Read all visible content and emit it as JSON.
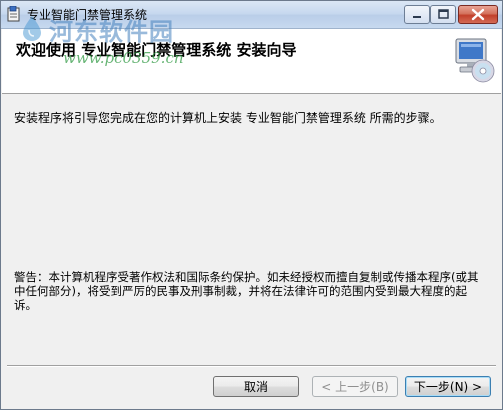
{
  "window": {
    "title": "专业智能门禁管理系统"
  },
  "watermark": {
    "site_name": "河东软件园",
    "url": "www.pc0359.cn"
  },
  "header": {
    "title": "欢迎使用 专业智能门禁管理系统 安装向导"
  },
  "content": {
    "intro": "安装程序将引导您完成在您的计算机上安装 专业智能门禁管理系统 所需的步骤。",
    "warning": "警告：本计算机程序受著作权法和国际条约保护。如未经授权而擅自复制或传播本程序(或其中任何部分)，将受到严厉的民事及刑事制裁，并将在法律许可的范围内受到最大程度的起诉。"
  },
  "buttons": {
    "cancel": "取消",
    "back": "< 上一步(B)",
    "next": "下一步(N) >"
  },
  "colors": {
    "titlebar": "#c7d9ef",
    "close_button": "#c2402b",
    "body_background": "#f0f0f0"
  },
  "icons": {
    "app": "installer-app-icon",
    "header": "computer-cd-icon"
  }
}
